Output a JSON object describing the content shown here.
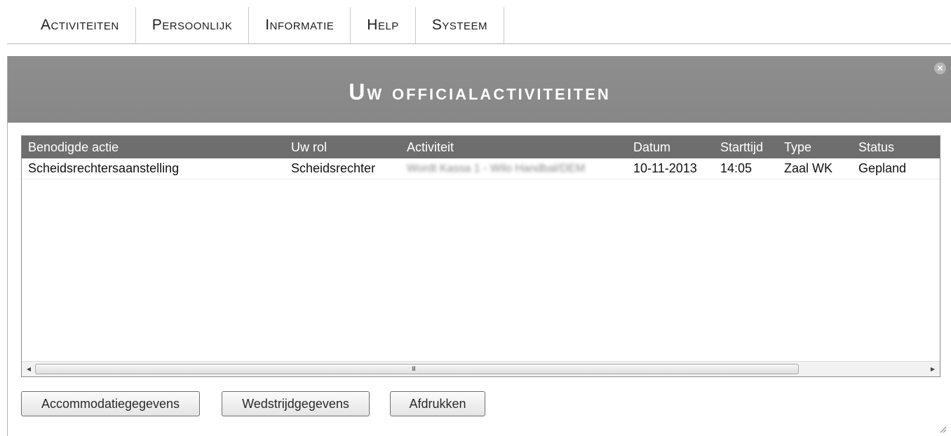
{
  "menu": {
    "items": [
      {
        "label": "Activiteiten"
      },
      {
        "label": "Persoonlijk"
      },
      {
        "label": "Informatie"
      },
      {
        "label": "Help"
      },
      {
        "label": "Systeem"
      }
    ]
  },
  "dialog": {
    "title": "Uw officialactiviteiten",
    "close_icon": "close-icon"
  },
  "grid": {
    "columns": [
      "Benodigde actie",
      "Uw rol",
      "Activiteit",
      "Datum",
      "Starttijd",
      "Type",
      "Status"
    ],
    "rows": [
      {
        "benodigde_actie": "Scheidsrechtersaanstelling",
        "uw_rol": "Scheidsrechter",
        "activiteit": "Wordt Kassa 1 - Wilo Handbal/DEM",
        "datum": "10-11-2013",
        "starttijd": "14:05",
        "type": "Zaal WK",
        "status": "Gepland"
      }
    ],
    "scrollbar_grip": "III"
  },
  "buttons": {
    "accommodatie": "Accommodatiegegevens",
    "wedstrijd": "Wedstrijdgegevens",
    "afdrukken": "Afdrukken"
  },
  "colors": {
    "header_bg": "#8a8a8a",
    "grid_header_bg": "#6e6e6e",
    "title_text": "#ffffff"
  }
}
